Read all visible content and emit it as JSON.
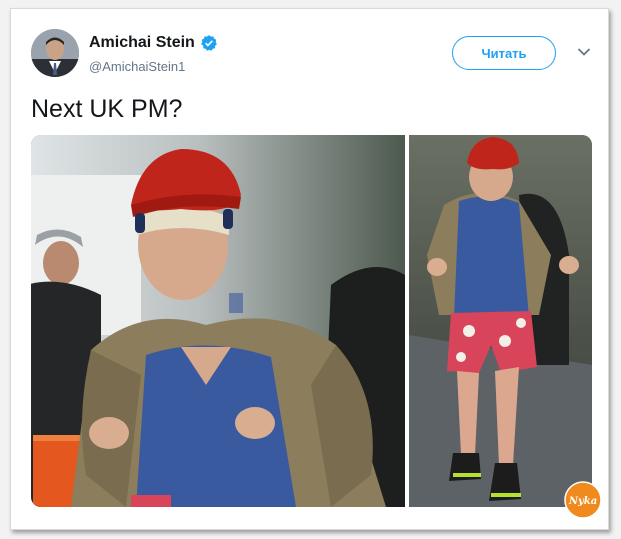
{
  "tweet": {
    "author_name": "Amichai Stein",
    "author_handle": "@AmichaiStein1",
    "follow_label": "Читать",
    "text": "Next UK PM?"
  },
  "icons": {
    "verified": "verified-badge-icon",
    "menu": "chevron-down-icon"
  },
  "watermark": {
    "label": "Nyka"
  },
  "colors": {
    "accent": "#1da1f2",
    "name_text": "#14171a",
    "handle_text": "#657786"
  }
}
